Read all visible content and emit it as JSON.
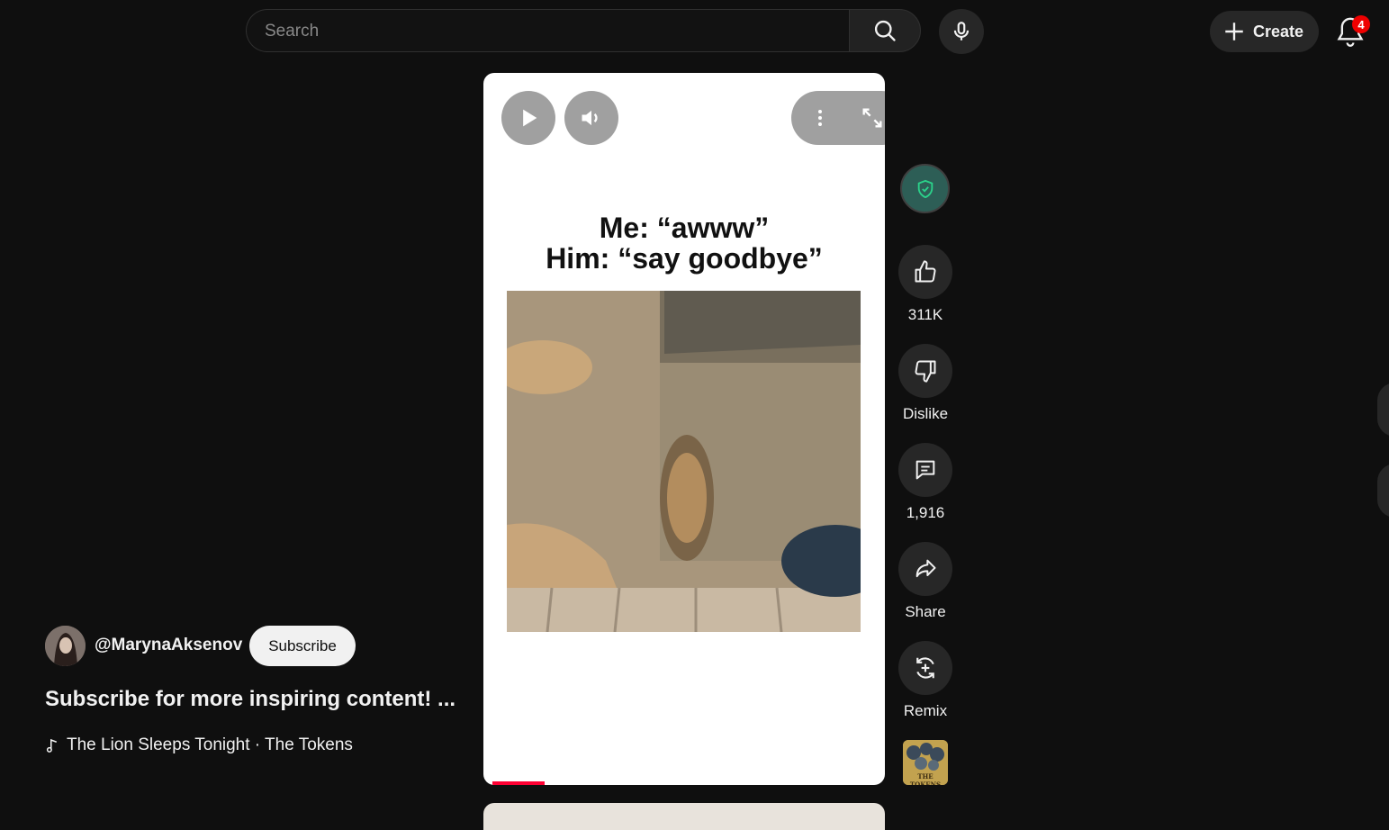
{
  "header": {
    "search_placeholder": "Search",
    "create_label": "Create",
    "notification_count": "4"
  },
  "video": {
    "caption_line1": "Me: “awww”",
    "caption_line2": "Him: “say goodbye”",
    "progress_fraction": 0.13
  },
  "actions": {
    "like_count": "311K",
    "dislike_label": "Dislike",
    "comment_count": "1,916",
    "share_label": "Share",
    "remix_label": "Remix",
    "album_text": "THE TOKENS"
  },
  "channel": {
    "handle": "@MarynaAksenov",
    "subscribe_label": "Subscribe",
    "title": "Subscribe for more inspiring content! ...",
    "music": "The Lion Sleeps Tonight · The Tokens"
  },
  "colors": {
    "background": "#0f0f0f",
    "accent_red": "#ff0033",
    "badge_red": "#ee0000"
  }
}
